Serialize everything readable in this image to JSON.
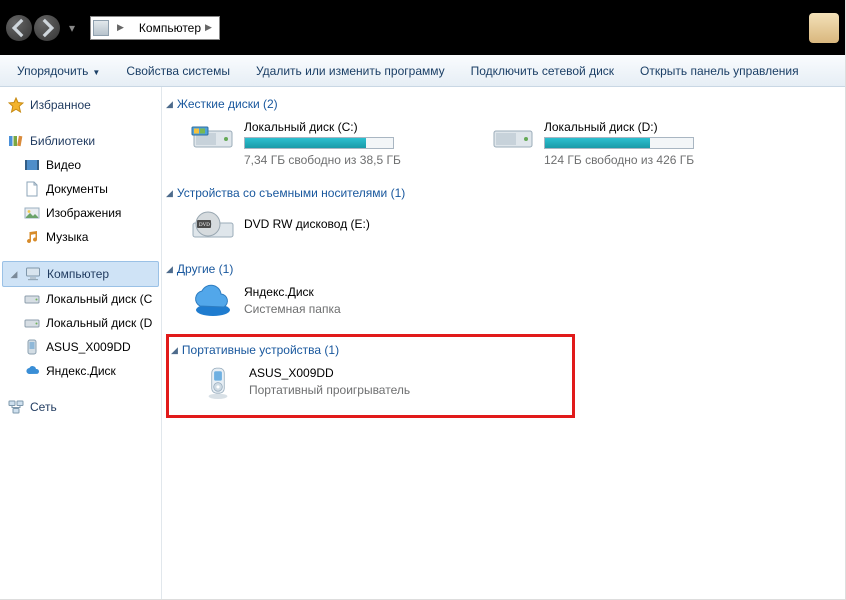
{
  "address": {
    "root_label": "Компьютер"
  },
  "toolbar": {
    "organize": "Упорядочить",
    "properties": "Свойства системы",
    "uninstall": "Удалить или изменить программу",
    "map": "Подключить сетевой диск",
    "control": "Открыть панель управления"
  },
  "sidebar": {
    "favorites": "Избранное",
    "libraries": "Библиотеки",
    "video": "Видео",
    "documents": "Документы",
    "images": "Изображения",
    "music": "Музыка",
    "computer": "Компьютер",
    "drive_c": "Локальный диск (C",
    "drive_d": "Локальный диск (D",
    "asus": "ASUS_X009DD",
    "yadisk": "Яндекс.Диск",
    "network": "Сеть"
  },
  "sections": {
    "hdd_header": "Жесткие диски (2)",
    "drive_c": {
      "name": "Локальный диск (C:)",
      "info": "7,34 ГБ свободно из 38,5 ГБ",
      "fill_pct": 82
    },
    "drive_d": {
      "name": "Локальный диск (D:)",
      "info": "124 ГБ свободно из 426 ГБ",
      "fill_pct": 71
    },
    "removable_header": "Устройства со съемными носителями (1)",
    "dvd_name": "DVD RW дисковод (E:)",
    "other_header": "Другие (1)",
    "yadisk_name": "Яндекс.Диск",
    "yadisk_sub": "Системная папка",
    "portable_header": "Портативные устройства (1)",
    "portable_name": "ASUS_X009DD",
    "portable_sub": "Портативный проигрыватель"
  }
}
